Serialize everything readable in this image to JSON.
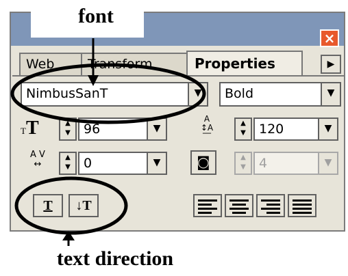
{
  "annotations": {
    "font_label": "font",
    "direction_label": "text direction"
  },
  "panel": {
    "tabs": [
      "Web",
      "Transform",
      "Properties"
    ],
    "tab_scroll_icon": "right-arrow-icon",
    "close_icon": "close-icon",
    "font": {
      "value": "NimbusSanT",
      "style": "Bold"
    },
    "size": {
      "icon_text": "T",
      "value": "96"
    },
    "leading": {
      "value": "120"
    },
    "kerning": {
      "value": "0"
    },
    "horizontal_scale": {
      "value": "4"
    },
    "direction_buttons": {
      "horizontal": "T",
      "vertical": "↓T"
    }
  },
  "colors": {
    "titlebar": "#7f96b8",
    "panel_bg": "#e7e4d9",
    "close": "#e8592c"
  }
}
